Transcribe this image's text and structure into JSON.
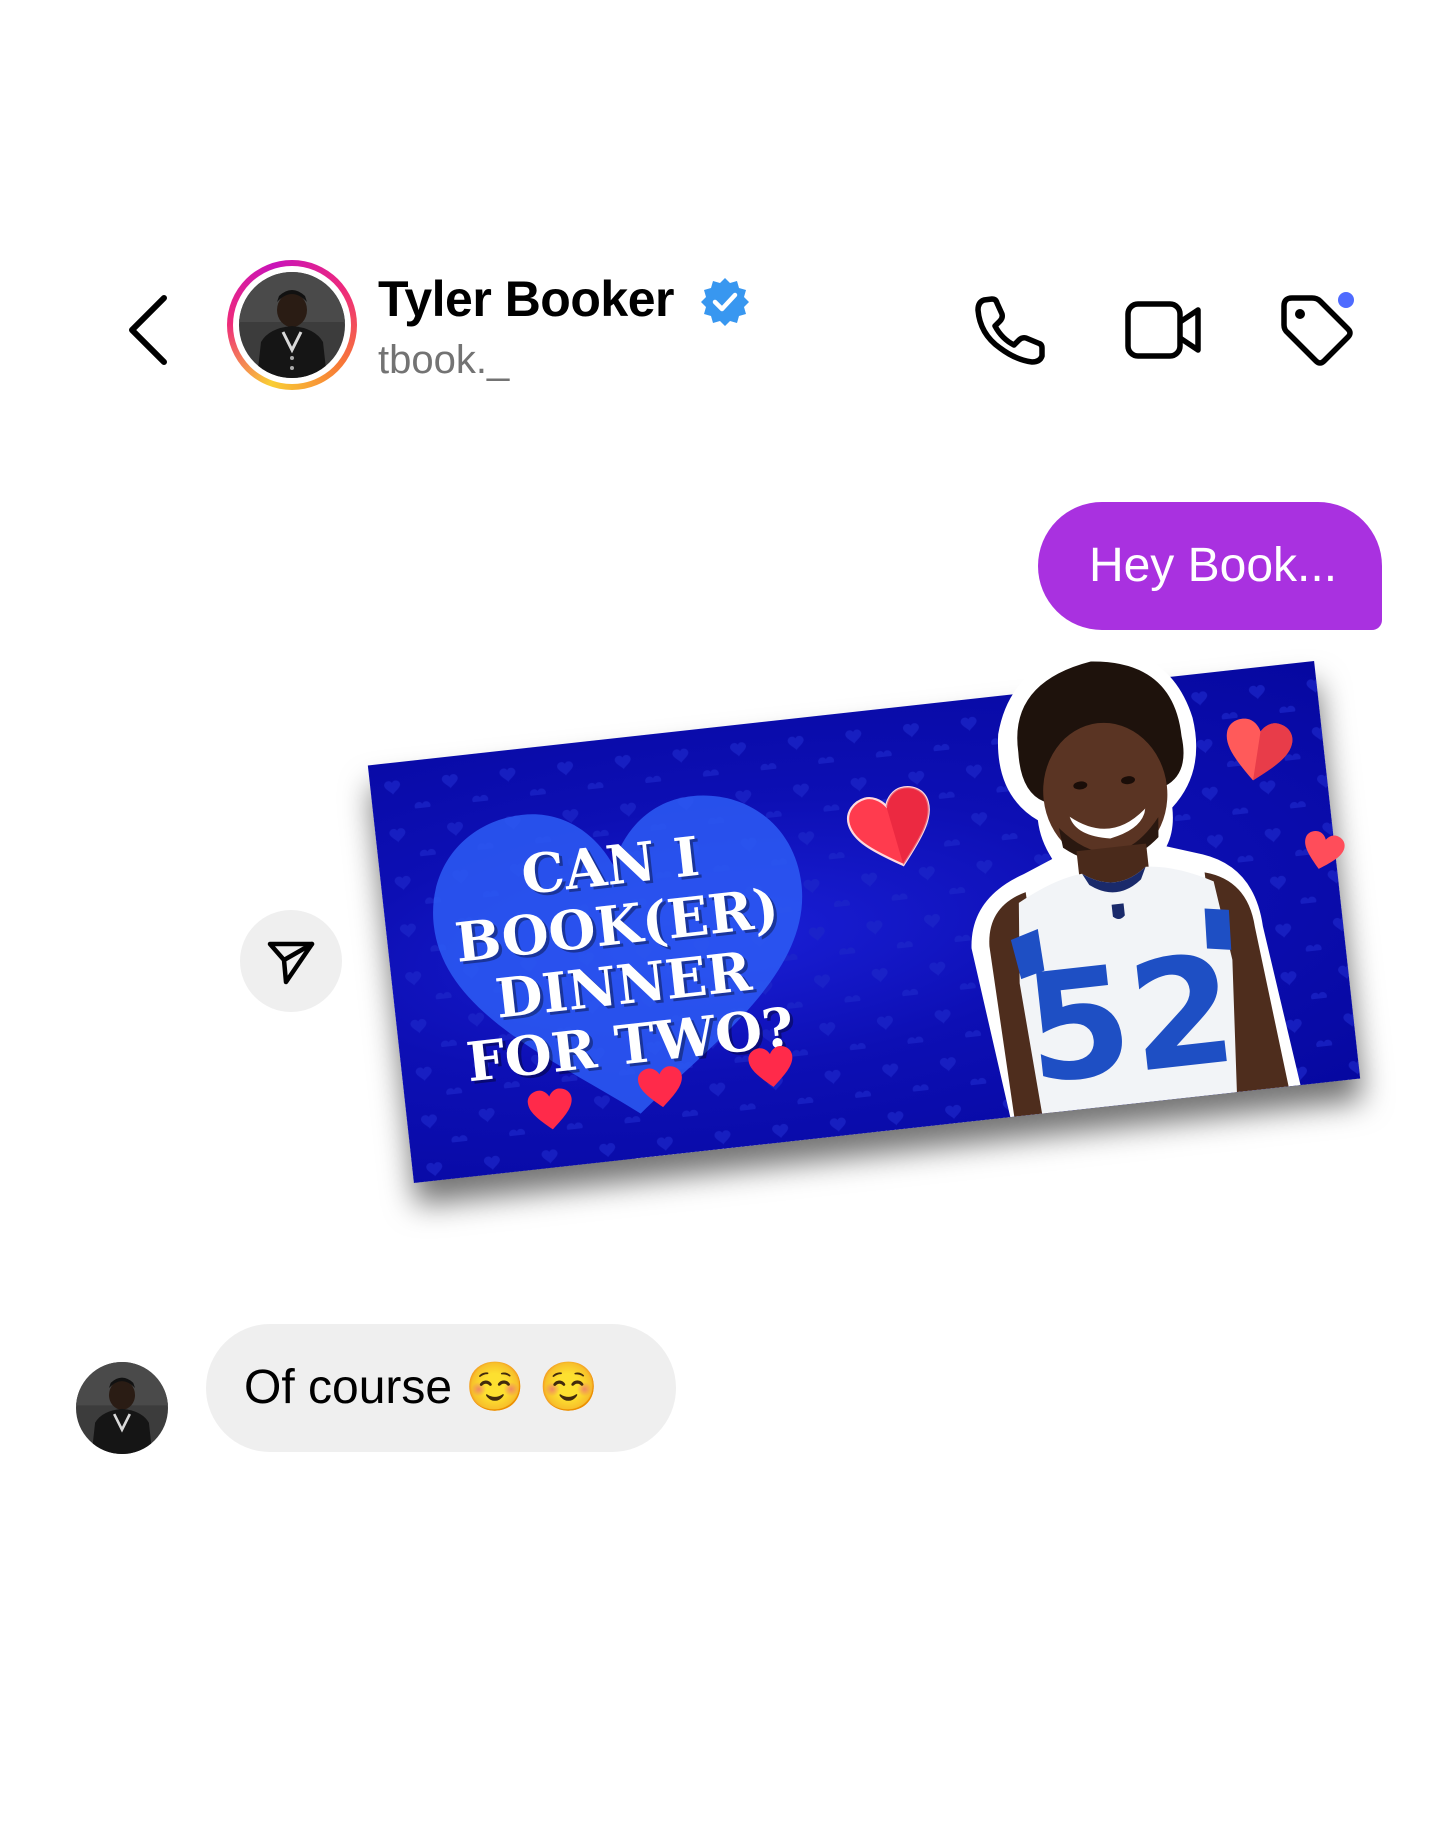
{
  "header": {
    "name": "Tyler Booker",
    "handle": "tbook._",
    "verified": true,
    "icons": [
      "back-chevron-icon",
      "phone-icon",
      "video-camera-icon",
      "tag-icon"
    ],
    "notification_dot_color": "#4f6bff"
  },
  "messages": {
    "outgoing_text": "Hey Book...",
    "incoming_text": "Of course ☺️ ☺️"
  },
  "card": {
    "headline_lines": [
      "CAN I",
      "BOOK(ER)",
      "DINNER",
      "FOR TWO?"
    ],
    "jersey_number": "52",
    "background_color": "#0b0fb0"
  },
  "colors": {
    "accent_purple": "#a931e0",
    "verified_blue": "#3897f0",
    "incoming_bubble": "#efefef"
  }
}
